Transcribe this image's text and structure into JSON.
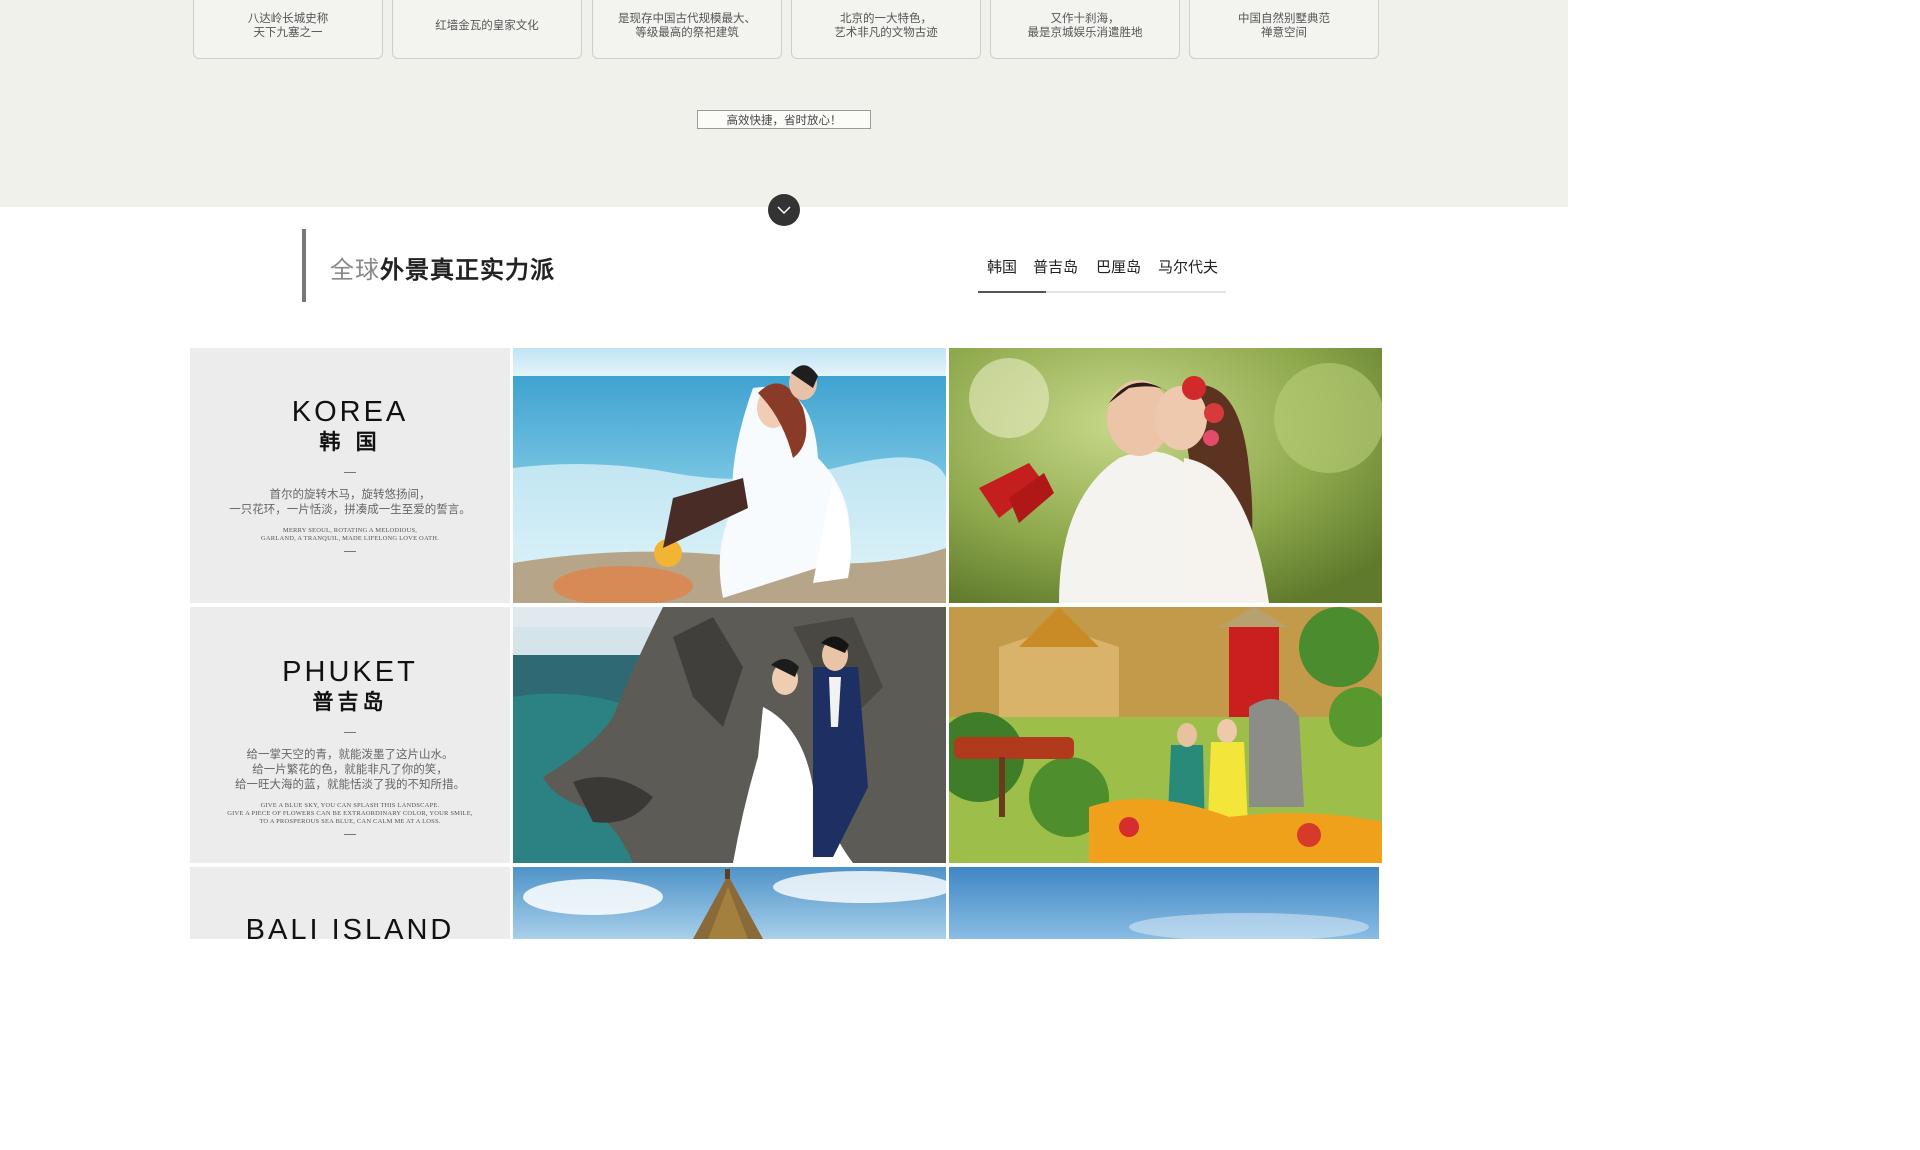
{
  "attractions": [
    {
      "line1": "八达岭长城史称",
      "line2": "天下九塞之一"
    },
    {
      "line1": "红墙金瓦的皇家文化",
      "line2": ""
    },
    {
      "line1": "是现存中国古代规模最大、",
      "line2": "等级最高的祭祀建筑"
    },
    {
      "line1": "北京的一大特色，",
      "line2": "艺术非凡的文物古迹"
    },
    {
      "line1": "又作十刹海，",
      "line2": "最是京城娱乐消遣胜地"
    },
    {
      "line1": "中国自然别墅典范",
      "line2": "禅意空间"
    }
  ],
  "cta": {
    "label": "高效快捷，省时放心！"
  },
  "section": {
    "title_light": "全球",
    "title_bold": "外景真正实力派"
  },
  "tabs": [
    "韩国",
    "普吉岛",
    "巴厘岛",
    "马尔代夫"
  ],
  "destinations": [
    {
      "en": "KOREA",
      "cn": "韩 国",
      "desc_cn": [
        "首尔的旋转木马，旋转悠扬间，",
        "一只花环，一片恬淡，拼凑成一生至爱的誓言。"
      ],
      "desc_en": [
        "MERRY SEOUL, ROTATING A MELODIOUS,",
        "GARLAND, A TRANQUIL, MADE LIFELONG LOVE OATH."
      ]
    },
    {
      "en": "PHUKET",
      "cn": "普吉岛",
      "desc_cn": [
        "给一掌天空的青，就能泼墨了这片山水。",
        "给一片繁花的色，就能非凡了你的笑，",
        "给一旺大海的蓝，就能恬淡了我的不知所措。"
      ],
      "desc_en": [
        "GIVE A BLUE SKY, YOU CAN SPLASH THIS LANDSCAPE.",
        "GIVE A PIECE OF FLOWERS CAN BE EXTRAORDINARY COLOR, YOUR SMILE,",
        "TO A PROSPEROUS SEA BLUE, CAN CALM ME AT A LOSS."
      ]
    },
    {
      "en": "BALI ISLAND",
      "cn": "",
      "desc_cn": [],
      "desc_en": []
    }
  ],
  "colors": {
    "band": "#f1f1ec",
    "panel": "#ececec",
    "dark": "#333333"
  }
}
